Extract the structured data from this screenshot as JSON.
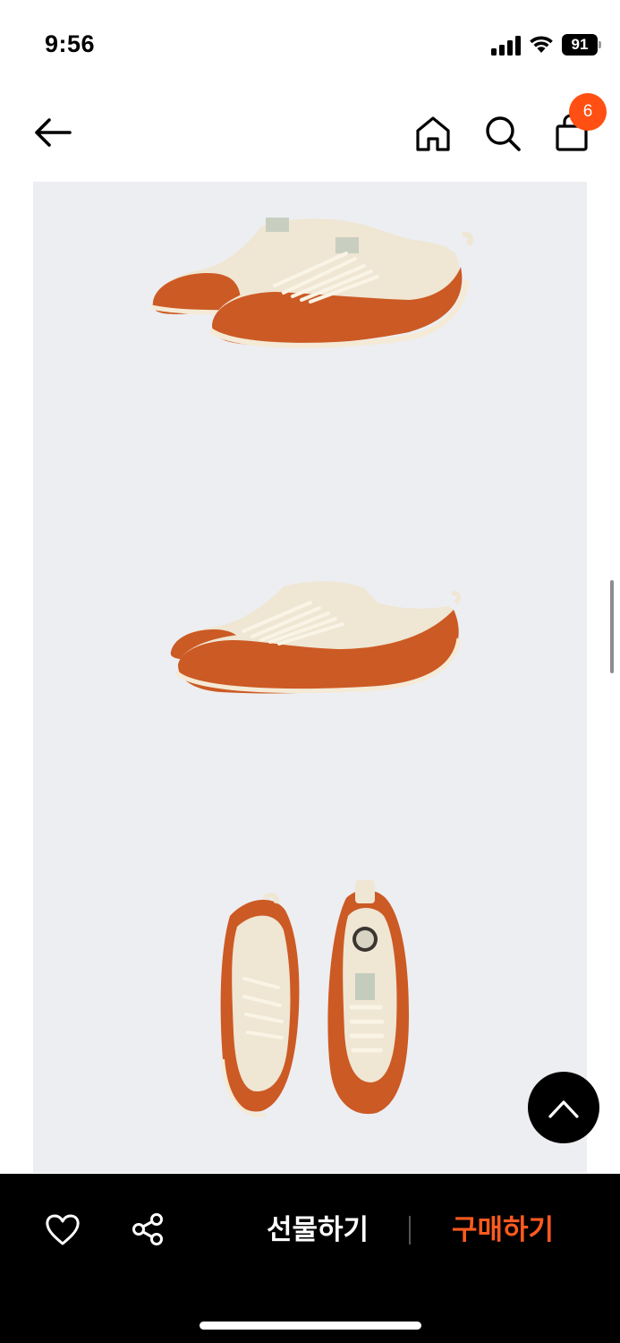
{
  "status_bar": {
    "time": "9:56",
    "battery_level": "91"
  },
  "header": {
    "icons": [
      "back-arrow-icon",
      "home-icon",
      "search-icon",
      "shopping-bag-icon"
    ],
    "cart_count": "6"
  },
  "gallery": {
    "images": [
      "sneaker-pair-front-angle",
      "sneaker-pair-side-view",
      "sneaker-pair-top-view"
    ],
    "shoe_colors": {
      "canvas": "#efe6d3",
      "rubber": "#cc5a24",
      "sole": "#f4ead6"
    }
  },
  "bottom_bar": {
    "gift_label": "선물하기",
    "buy_label": "구매하기",
    "icons": [
      "heart-icon",
      "share-icon"
    ]
  },
  "colors": {
    "accent": "#ff4f12",
    "buy_text": "#ff5a1f",
    "bottom_bar_bg": "#000000",
    "gallery_bg": "#edeef1"
  }
}
